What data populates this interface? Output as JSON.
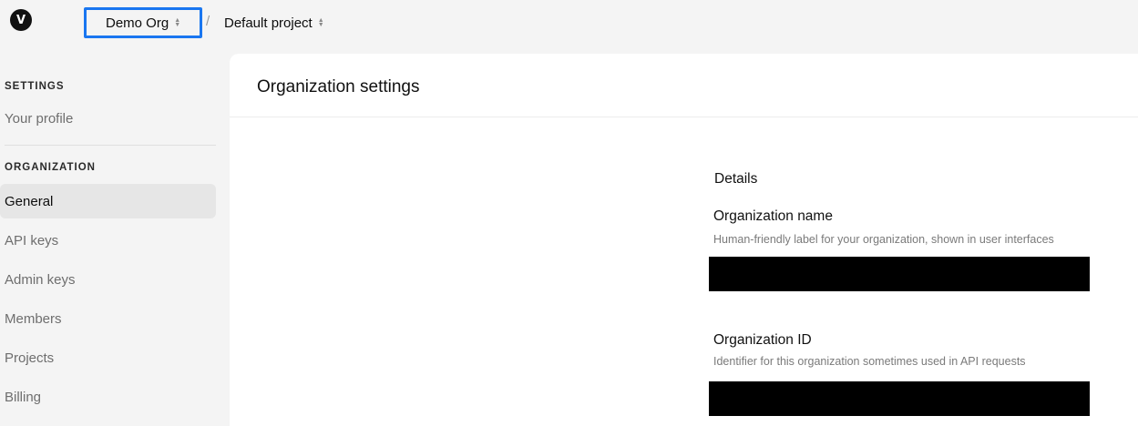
{
  "header": {
    "logo_letter": "V",
    "org_name": "Demo Org",
    "separator": "/",
    "project_name": "Default project"
  },
  "sidebar": {
    "settings_label": "SETTINGS",
    "settings_items": [
      {
        "label": "Your profile"
      }
    ],
    "organization_label": "ORGANIZATION",
    "organization_items": [
      {
        "label": "General",
        "active": true
      },
      {
        "label": "API keys"
      },
      {
        "label": "Admin keys"
      },
      {
        "label": "Members"
      },
      {
        "label": "Projects"
      },
      {
        "label": "Billing"
      }
    ]
  },
  "main": {
    "title": "Organization settings",
    "details_heading": "Details",
    "fields": [
      {
        "label": "Organization name",
        "description": "Human-friendly label for your organization, shown in user interfaces",
        "value_redacted": true
      },
      {
        "label": "Organization ID",
        "description": "Identifier for this organization sometimes used in API requests",
        "value_redacted": true
      }
    ]
  },
  "colors": {
    "highlight_border": "#1976f0",
    "background": "#f4f4f4",
    "panel": "#ffffff",
    "active_item": "#e6e6e6"
  }
}
